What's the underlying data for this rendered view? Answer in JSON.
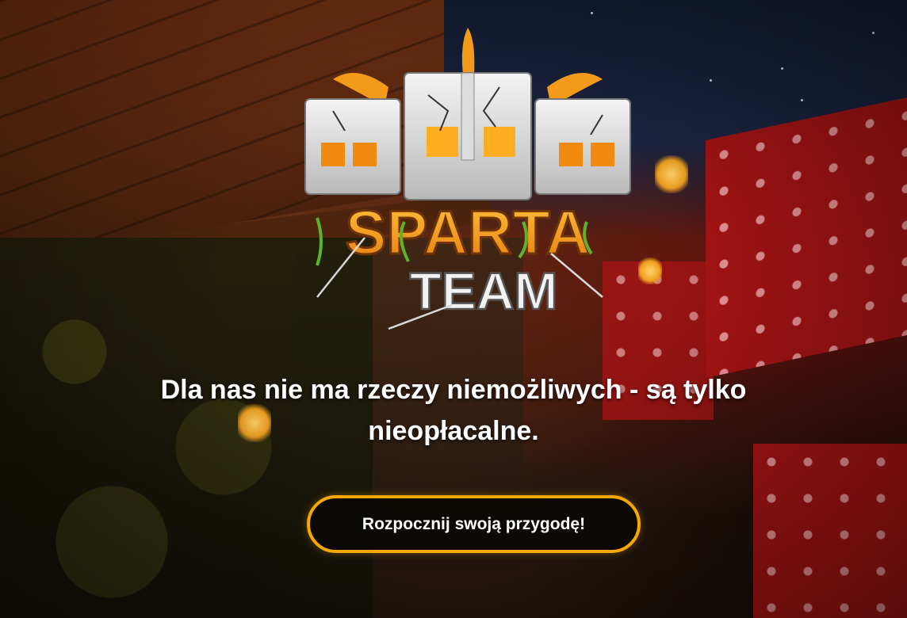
{
  "logo": {
    "line1": "SPARTA",
    "line2": "TEAM"
  },
  "hero": {
    "tagline": "Dla nas nie ma rzeczy niemożliwych - są tylko nieopłacalne.",
    "cta_label": "Rozpocznij swoją przygodę!"
  },
  "colors": {
    "accent": "#f5a800",
    "text": "#ffffff",
    "logo_orange": "#f39a1b"
  }
}
